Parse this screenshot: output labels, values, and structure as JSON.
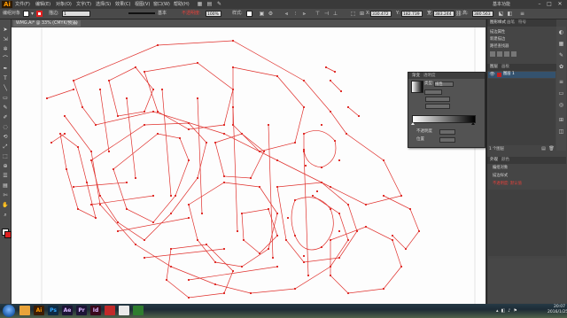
{
  "app": {
    "logo": "Ai",
    "workspace_label": "基本功能"
  },
  "menu": [
    "文件(F)",
    "编辑(E)",
    "对象(O)",
    "文字(T)",
    "选择(S)",
    "效果(C)",
    "视图(V)",
    "窗口(W)",
    "帮助(H)"
  ],
  "window_controls": {
    "minimize": "–",
    "maximize": "□",
    "close": "✕"
  },
  "control_bar": {
    "selection_label": "编组对象",
    "stroke_label": "描边:",
    "stroke_value": "1",
    "style_label": "基本",
    "opacity_label": "不透明度:",
    "opacity_value": "100%",
    "style2_label": "样式:",
    "x_label": "X:",
    "x_value": "330.472",
    "y_label": "Y:",
    "y_value": "182.739",
    "w_label": "宽:",
    "w_value": "383.244",
    "h_label": "高:",
    "h_value": "380.563",
    "colors": {
      "fill": "#ffffff",
      "stroke": "#e02020"
    }
  },
  "document": {
    "tab_label": "WMG.Ai* @ 33% (CMYK/预览)"
  },
  "gradient_panel": {
    "tabs": [
      "渐变",
      "透明度"
    ],
    "type_label": "类型:",
    "type_value": "线性",
    "angle_label": "不透明度",
    "location_label": "位置"
  },
  "right_panels": {
    "top_tabs": [
      "图形样式",
      "画笔",
      "符号"
    ],
    "rows_top": [
      "描边属性",
      "新建描边",
      "路径查找器"
    ],
    "layers_tabs": [
      "图层",
      "画板"
    ],
    "layer_name": "图层 1",
    "layer_count": "1 个图层",
    "bottom_tabs": [
      "外观",
      "颜色"
    ],
    "bottom_rows": [
      "编组对象",
      "描边样式",
      "不透明度: 默认值"
    ]
  },
  "taskbar": {
    "apps": [
      {
        "label": "",
        "color": "#e8a33a"
      },
      {
        "label": "Ai",
        "color": "#3b1d05"
      },
      {
        "label": "Ps",
        "color": "#0d2a44"
      },
      {
        "label": "Ae",
        "color": "#1d1436"
      },
      {
        "label": "Pr",
        "color": "#1d1436"
      },
      {
        "label": "Id",
        "color": "#3a0a1c"
      },
      {
        "label": "",
        "color": "#c02a2a"
      },
      {
        "label": "",
        "color": "#eaeaea"
      },
      {
        "label": "",
        "color": "#2f7d2f"
      }
    ],
    "time": "20:07",
    "date": "2016/1/25"
  },
  "colors": {
    "path_red": "#e0302c",
    "canvas": "#fdfdfd"
  }
}
